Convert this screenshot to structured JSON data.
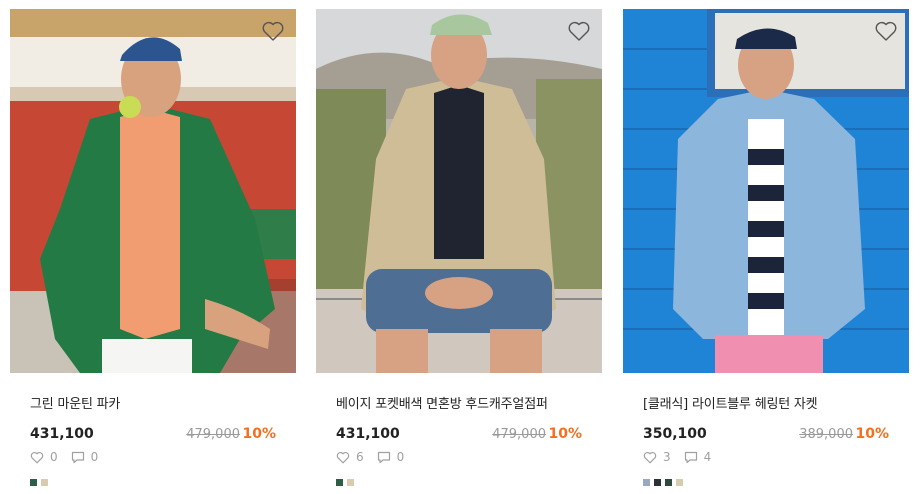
{
  "products": [
    {
      "name": "그린 마운틴 파카",
      "price": "431,100",
      "original_price": "479,000",
      "discount": "10%",
      "likes": "0",
      "reviews": "0",
      "swatches": [
        "#2e5e48",
        "#d8ccb0"
      ],
      "image_alt": "green parka model"
    },
    {
      "name": "베이지 포켓배색 면혼방 후드캐주얼점퍼",
      "price": "431,100",
      "original_price": "479,000",
      "discount": "10%",
      "likes": "6",
      "reviews": "0",
      "swatches": [
        "#2e5e48",
        "#d8ccb0"
      ],
      "image_alt": "beige hooded jacket model"
    },
    {
      "name": "[클래식] 라이트블루 헤링턴 자켓",
      "price": "350,100",
      "original_price": "389,000",
      "discount": "10%",
      "likes": "3",
      "reviews": "4",
      "swatches": [
        "#9aa9c0",
        "#2c3138",
        "#2e4a3e",
        "#d8ccb0"
      ],
      "image_alt": "light blue harrington jacket model"
    }
  ],
  "icons": {
    "wishlist": "heart-outline-icon",
    "like": "heart-outline-icon",
    "review": "speech-bubble-icon"
  },
  "colors": {
    "discount": "#f36f21",
    "price": "#222222",
    "original_price": "#9a9a9a",
    "meta": "#a0a0a0"
  }
}
